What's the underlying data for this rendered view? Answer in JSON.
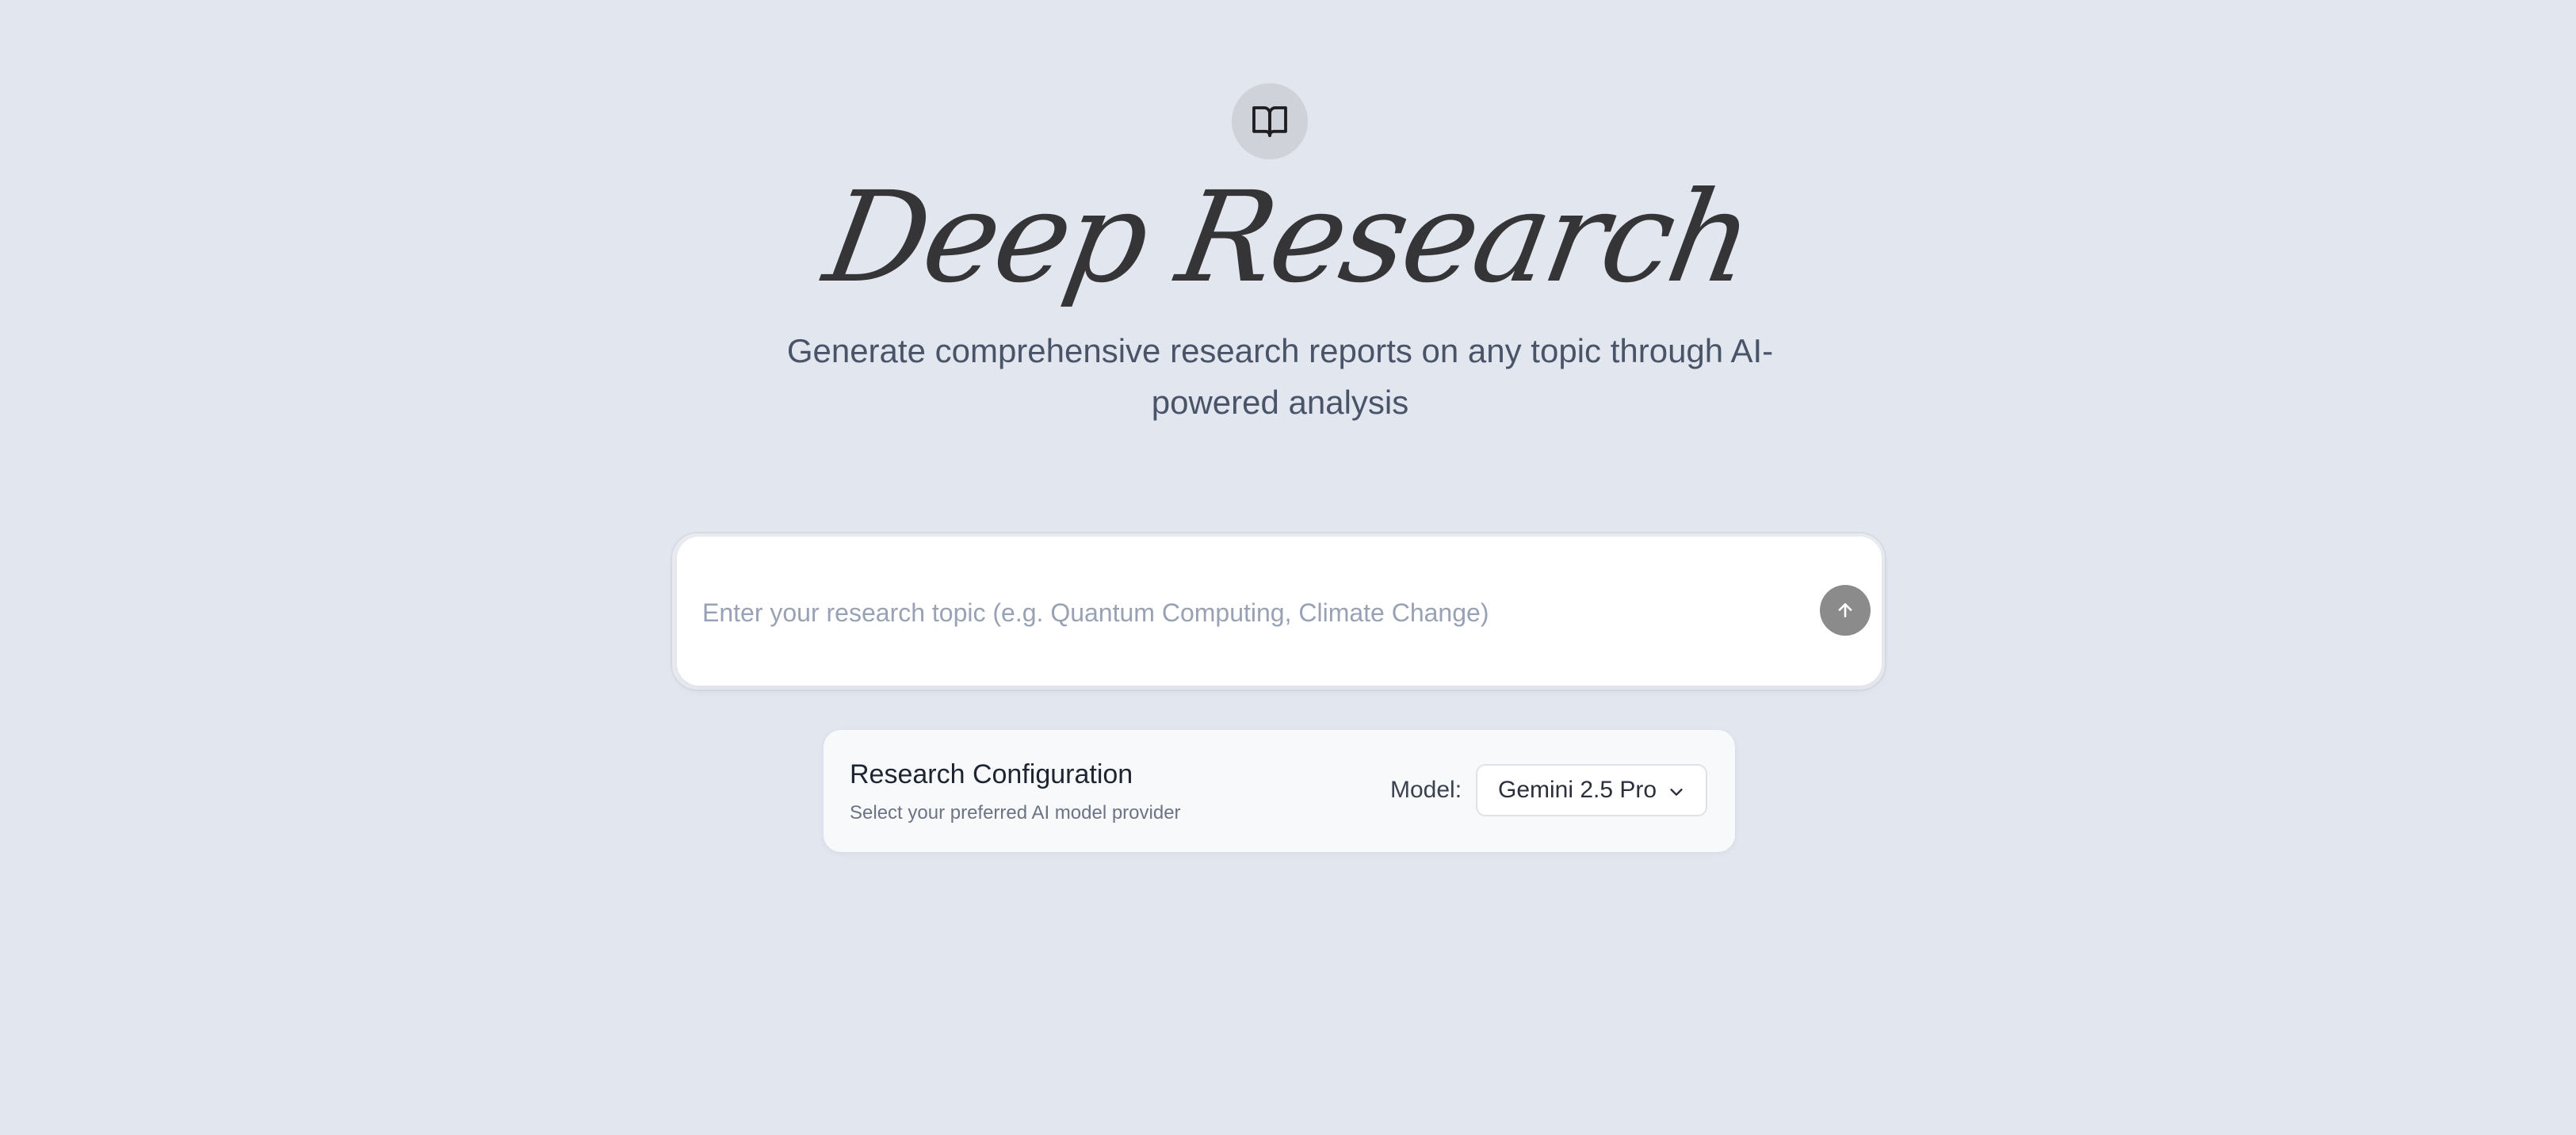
{
  "header": {
    "logo_icon": "open-book-icon",
    "title": "Deep Research",
    "subtitle": "Generate comprehensive research reports on any topic through AI-powered analysis"
  },
  "search": {
    "placeholder": "Enter your research topic (e.g. Quantum Computing, Climate Change)",
    "value": "",
    "submit_icon": "arrow-up-icon"
  },
  "config": {
    "title": "Research Configuration",
    "subtitle": "Select your preferred AI model provider",
    "model_label": "Model:",
    "model_value": "Gemini 2.5 Pro",
    "dropdown_icon": "chevron-down-icon"
  },
  "colors": {
    "background": "#e2e6ef",
    "title": "#353538",
    "submit_button": "#8b8b8b",
    "card": "#f8f9fb"
  }
}
